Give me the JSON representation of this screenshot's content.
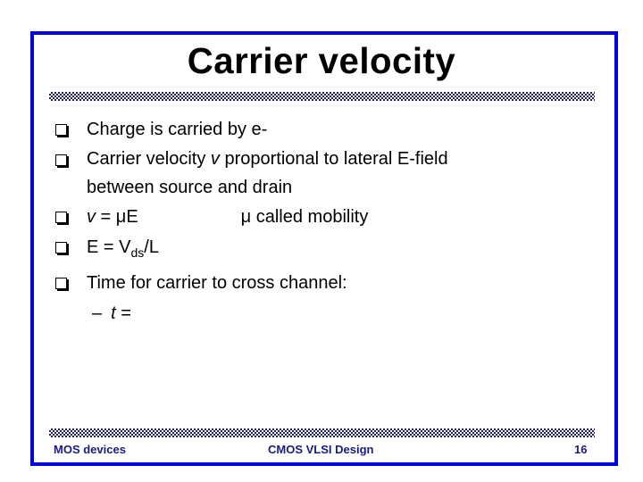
{
  "slide": {
    "title": "Carrier velocity",
    "colors": {
      "frame": "#0000e0",
      "bar": "#1a1a80",
      "footer_text": "#1a1a80",
      "text": "#000000"
    },
    "bullets": [
      {
        "text": "Charge is carried by e-"
      },
      {
        "line1_pre": "Carrier velocity ",
        "line1_var": "v",
        "line1_post": " proportional to lateral E-field",
        "line2": "between source and drain"
      },
      {
        "var": "v",
        "eq": " = μE",
        "note": "μ called mobility"
      },
      {
        "pre": "E = V",
        "sub": "ds",
        "post": "/L"
      },
      {
        "text": "Time for carrier to cross channel:"
      }
    ],
    "sub_bullet": {
      "dash": "–",
      "var": "t",
      "eq": " ="
    }
  },
  "footer": {
    "left": "MOS devices",
    "center": "CMOS VLSI Design",
    "page_number": "16"
  }
}
